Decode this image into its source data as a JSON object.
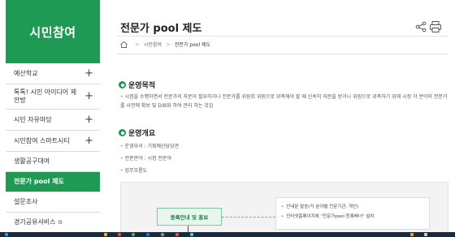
{
  "sidebar": {
    "header": "시민참여",
    "items": [
      {
        "label": "예산학교",
        "plus": true,
        "active": false
      },
      {
        "label": "톡톡! 시민 아이디어 제안방",
        "plus": true,
        "active": false
      },
      {
        "label": "시민 자유마당",
        "plus": true,
        "active": false
      },
      {
        "label": "시민참여 스마트시티",
        "plus": true,
        "active": false
      },
      {
        "label": "생활공구대여",
        "plus": false,
        "active": false
      },
      {
        "label": "전문가 pool 제도",
        "plus": false,
        "active": true
      },
      {
        "label": "설문조사",
        "plus": false,
        "active": false
      },
      {
        "label": "경기공유서비스",
        "plus": false,
        "active": false
      }
    ],
    "plus_symbol": "+",
    "external_symbol": "⧉"
  },
  "main": {
    "title": "전문가 pool 제도",
    "breadcrumb": {
      "sep": ">",
      "items": [
        "시민참여",
        "전문가 pool 제도"
      ]
    },
    "purpose": {
      "heading": "운영목적",
      "text": "시정을 수행하면서 전문가의 자문이 필요하거나 전문가를 위원회 위원으로 위촉해야 할 때 신속히 자문을 받거나 위원으로 위촉하기 위해 시정 각 분야의 전문가를 사전에 확보 및 D/B화 하여 관리 하는 것임"
    },
    "overview": {
      "heading": "운영개요",
      "items": [
        "운영부서 : 기획예산담당관",
        "전문분야 : 시정 전분야",
        "업무흐름도"
      ]
    },
    "flow": {
      "step_label": "등록안내 및 홍보",
      "details": [
        "안내문 발송(각 분야별 전문기관, 개인)",
        "인터넷홈페이지에 \"전문가pool 등록배너\" 설치"
      ]
    }
  },
  "colors": {
    "accent": "#1e9a55",
    "bullet_orange": "#e07b1a"
  },
  "icons": {
    "share": "share-icon",
    "print": "print-icon",
    "home": "home-icon"
  }
}
